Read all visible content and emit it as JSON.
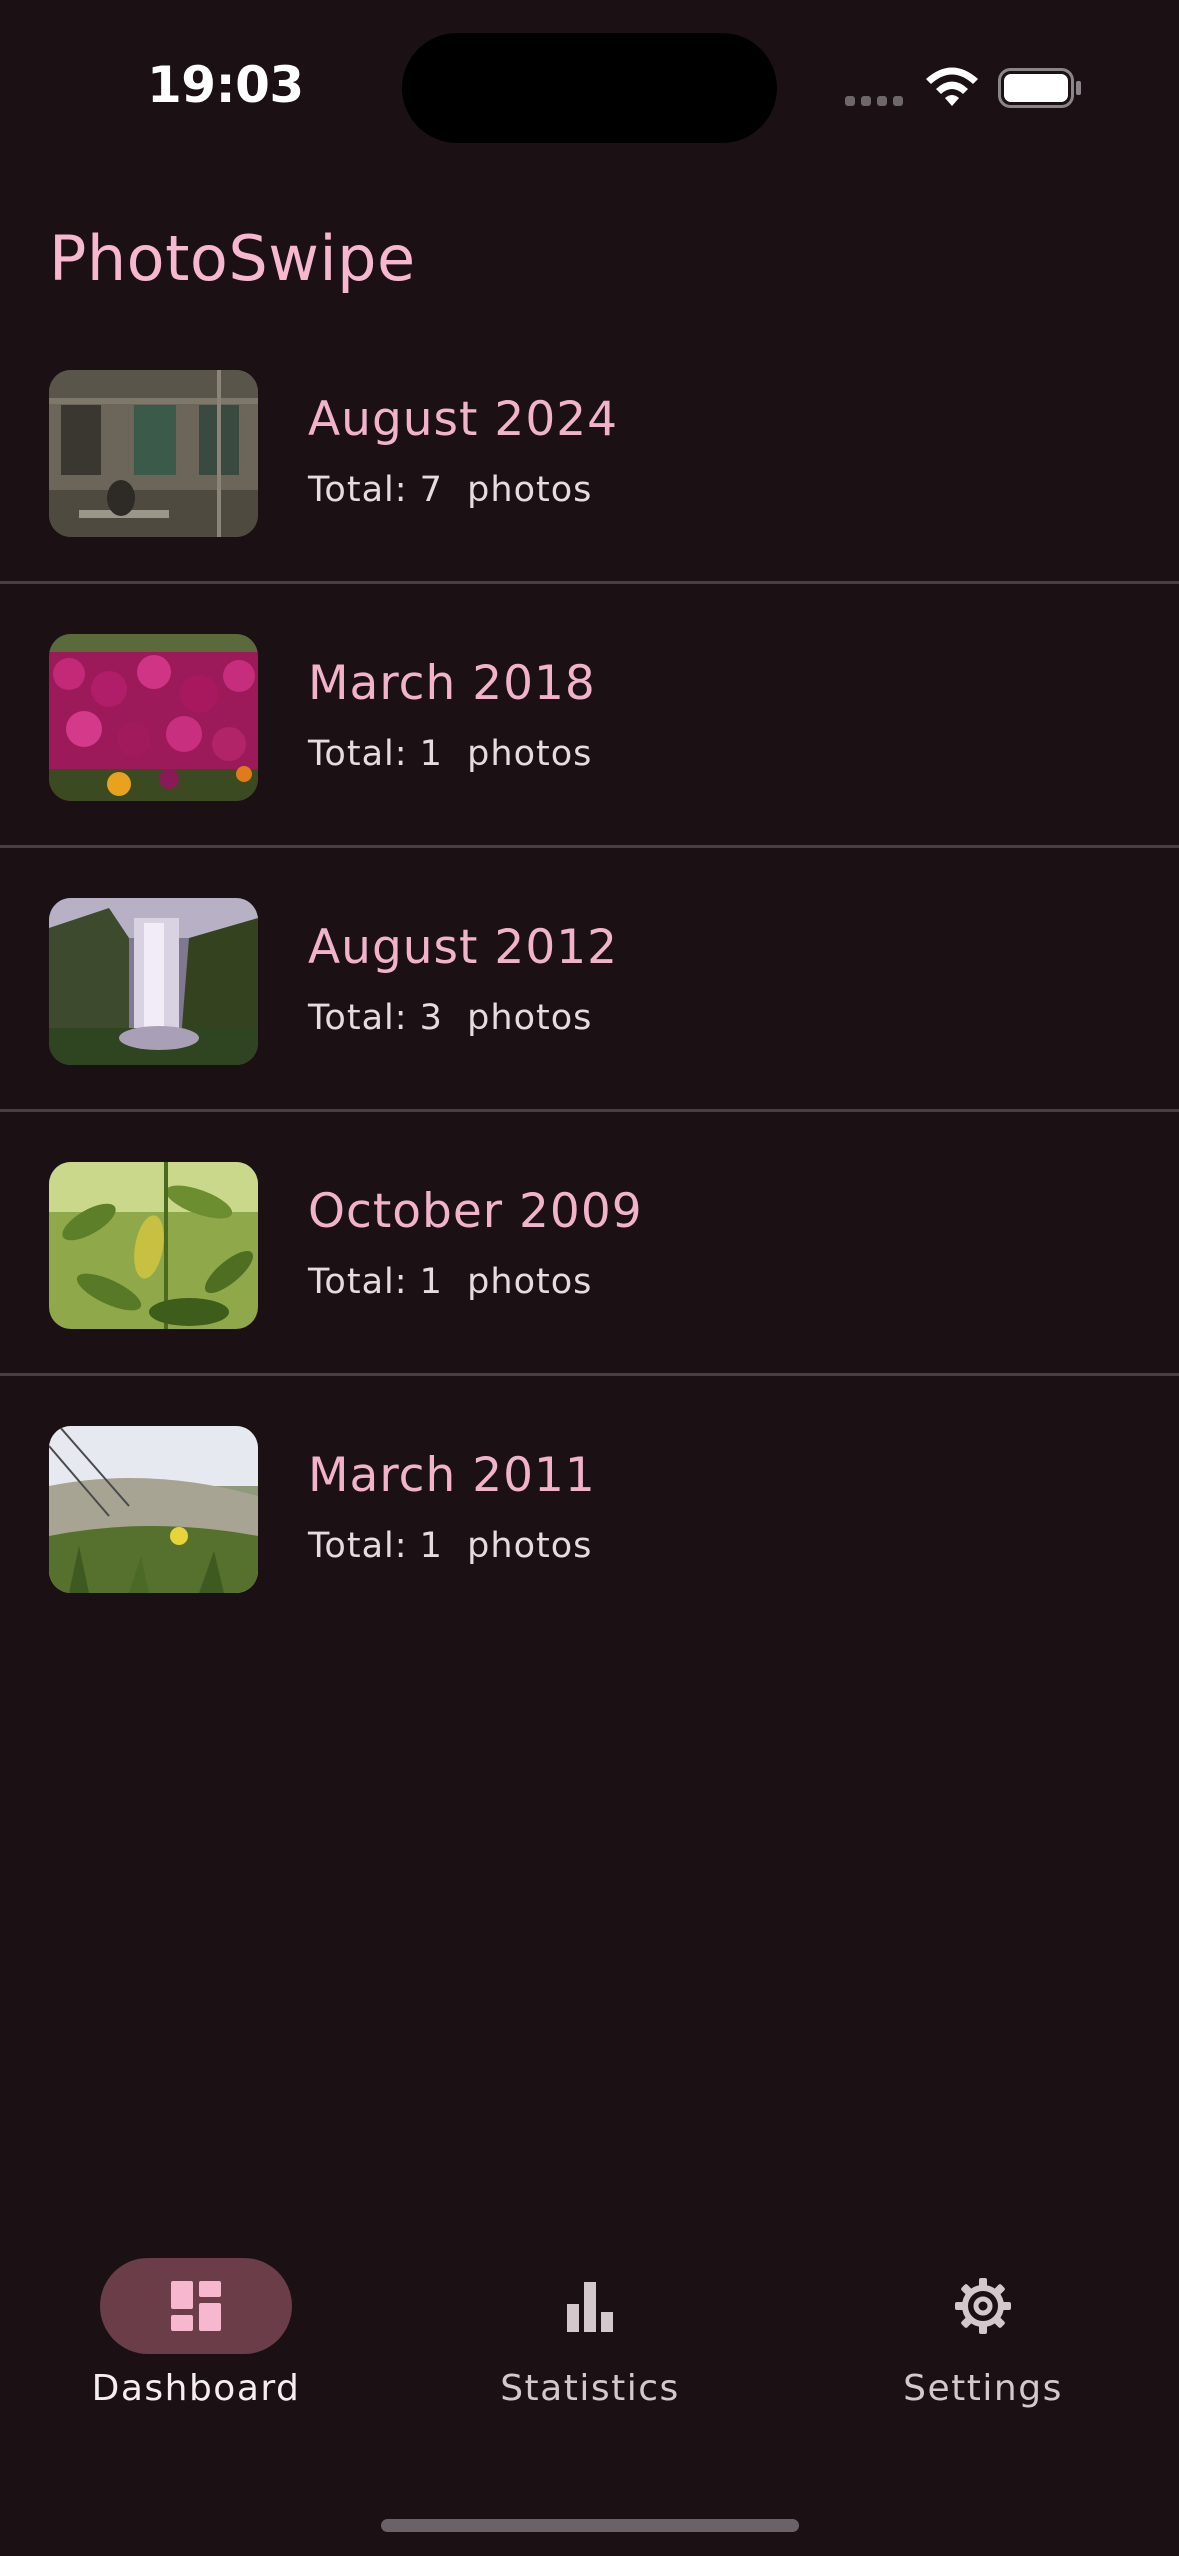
{
  "status_bar": {
    "time": "19:03",
    "icons": [
      "signal-dots-icon",
      "wifi-icon",
      "battery-icon"
    ]
  },
  "app": {
    "title": "PhotoSwipe",
    "accent_color": "#f2b3ca",
    "background_color": "#1b1115"
  },
  "albums": [
    {
      "title": "August 2024",
      "count_text": "Total: 7  photos",
      "thumbnail": "building-facade-photo"
    },
    {
      "title": "March 2018",
      "count_text": "Total: 1  photos",
      "thumbnail": "magenta-flowers-photo"
    },
    {
      "title": "August 2012",
      "count_text": "Total: 3  photos",
      "thumbnail": "waterfall-photo"
    },
    {
      "title": "October 2009",
      "count_text": "Total: 1  photos",
      "thumbnail": "green-foliage-photo"
    },
    {
      "title": "March 2011",
      "count_text": "Total: 1  photos",
      "thumbnail": "grassy-hill-photo"
    }
  ],
  "bottom_nav": {
    "items": [
      {
        "label": "Dashboard",
        "icon": "dashboard-icon",
        "active": true
      },
      {
        "label": "Statistics",
        "icon": "bar-chart-icon",
        "active": false
      },
      {
        "label": "Settings",
        "icon": "gear-icon",
        "active": false
      }
    ]
  }
}
